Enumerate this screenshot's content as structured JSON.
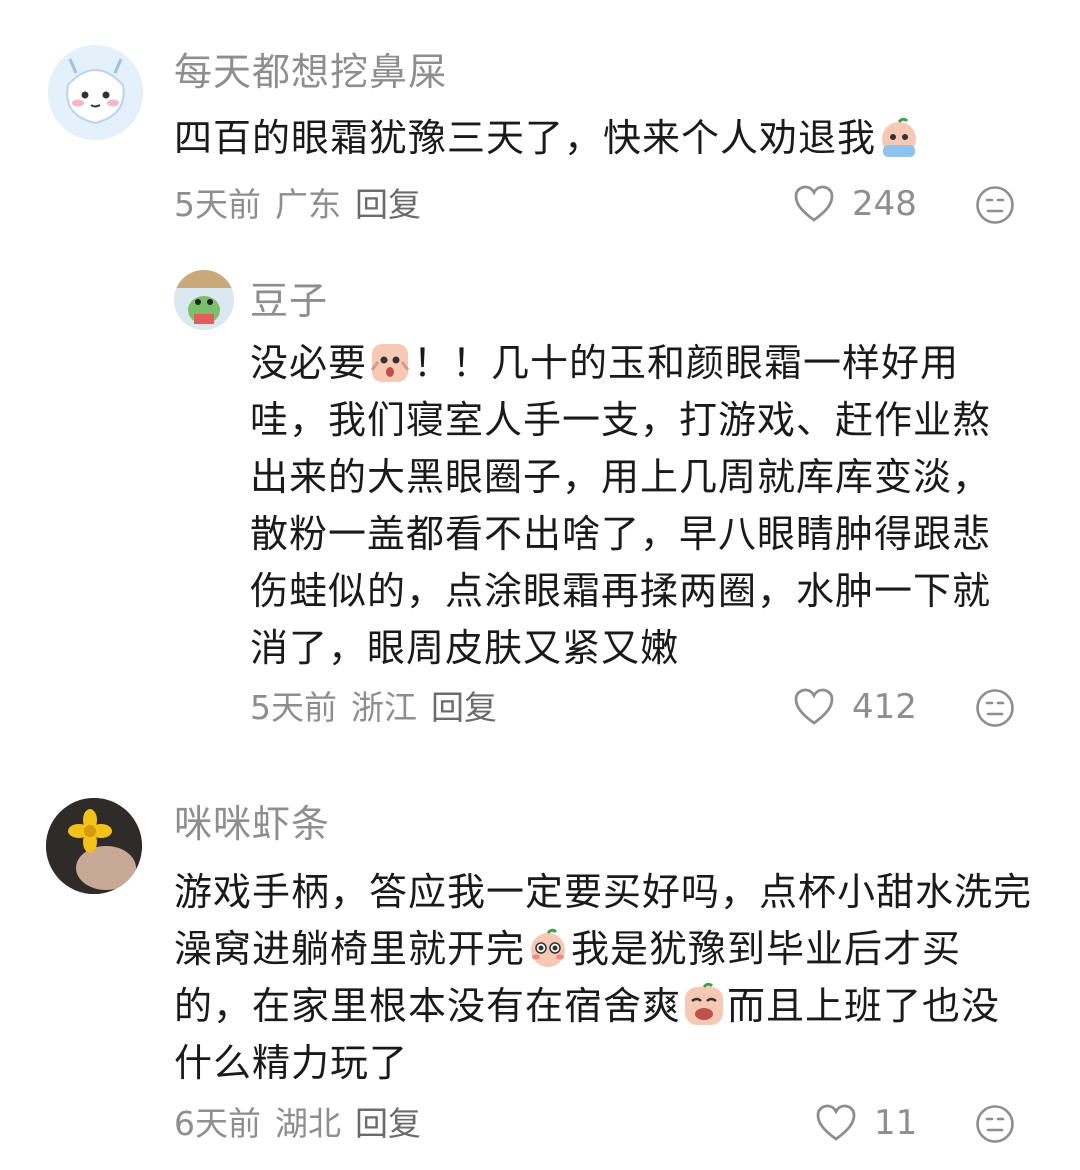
{
  "comments": [
    {
      "username": "每天都想挖鼻屎",
      "text_parts": [
        "四百的眼霜犹豫三天了，快来个人劝退我"
      ],
      "emojis": [
        "crying-emoji"
      ],
      "time": "5天前",
      "location": "广东",
      "reply_label": "回复",
      "likes": "248"
    },
    {
      "username": "豆子",
      "text_parts": [
        "没必要",
        "！！几十的玉和颜眼霜一样好用哇，我们寝室人手一支，打游戏、赶作业熬出来的大黑眼圈子，用上几周就库库变淡，散粉一盖都看不出啥了，早八眼睛肿得跟悲伤蛙似的，点涂眼霜再揉两圈，水肿一下就消了，眼周皮肤又紧又嫩"
      ],
      "emojis": [
        "shocked-emoji"
      ],
      "time": "5天前",
      "location": "浙江",
      "reply_label": "回复",
      "likes": "412"
    },
    {
      "username": "咪咪虾条",
      "text_parts": [
        "游戏手柄，答应我一定要买好吗，点杯小甜水洗完澡窝进躺椅里就开完",
        "我是犹豫到毕业后才买的，在家里根本没有在宿舍爽",
        "而且上班了也没什么精力玩了"
      ],
      "emojis": [
        "pleading-emoji",
        "crying-face-emoji"
      ],
      "time": "6天前",
      "location": "湖北",
      "reply_label": "回复",
      "likes": "11"
    }
  ],
  "colors": {
    "text": "#1a1a1a",
    "meta": "#8e8e8e",
    "emoji_skin": "#f6c9b4"
  }
}
